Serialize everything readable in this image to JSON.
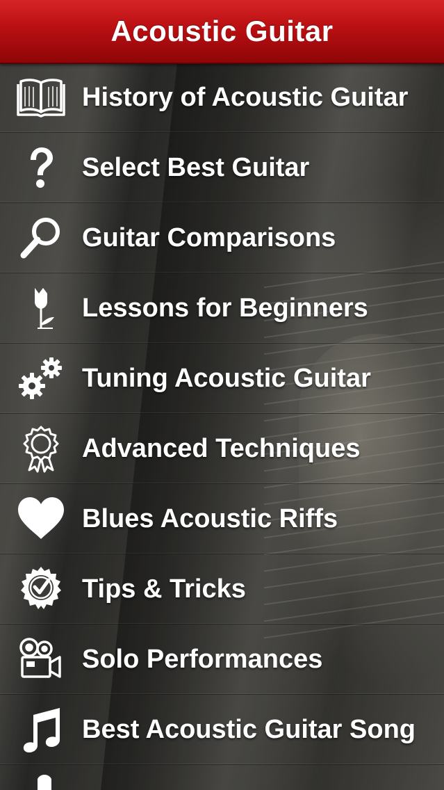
{
  "header": {
    "title": "Acoustic Guitar"
  },
  "menu": {
    "items": [
      {
        "label": "History of Acoustic Guitar",
        "icon": "book-icon"
      },
      {
        "label": "Select Best Guitar",
        "icon": "question-mark-icon"
      },
      {
        "label": "Guitar Comparisons",
        "icon": "magnifier-icon"
      },
      {
        "label": "Lessons for Beginners",
        "icon": "tulip-icon"
      },
      {
        "label": "Tuning Acoustic Guitar",
        "icon": "gears-icon"
      },
      {
        "label": "Advanced Techniques",
        "icon": "award-ribbon-icon"
      },
      {
        "label": "Blues Acoustic Riffs",
        "icon": "heart-icon"
      },
      {
        "label": "Tips & Tricks",
        "icon": "check-badge-icon"
      },
      {
        "label": "Solo Performances",
        "icon": "movie-camera-icon"
      },
      {
        "label": "Best Acoustic Guitar Song",
        "icon": "music-note-icon"
      }
    ]
  },
  "colors": {
    "header_top": "#d62426",
    "header_bottom": "#8e0609",
    "text": "#ffffff"
  }
}
